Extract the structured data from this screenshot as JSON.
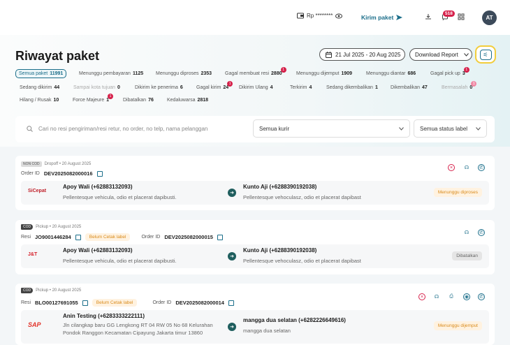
{
  "topbar": {
    "balance": "Rp ********",
    "kirim_paket": "Kirim paket",
    "notif_count": "518",
    "avatar": "AT"
  },
  "page": {
    "title": "Riwayat paket",
    "date_range": "21 Jul 2025 - 20 Aug 2025",
    "download_report": "Download Report"
  },
  "chips": [
    {
      "label": "Semua paket",
      "count": "11991"
    },
    {
      "label": "Menunggu pembayaran",
      "count": "1125"
    },
    {
      "label": "Menunggu diproses",
      "count": "2353"
    },
    {
      "label": "Gagal membuat resi",
      "count": "2880"
    },
    {
      "label": "Menunggu dijemput",
      "count": "1909"
    },
    {
      "label": "Menunggu diantar",
      "count": "686"
    },
    {
      "label": "Gagal pick up",
      "count": "3"
    },
    {
      "label": "Sedang dikirim",
      "count": "44"
    },
    {
      "label": "Sampai kota tujuan",
      "count": "0"
    },
    {
      "label": "Dikirim ke penerima",
      "count": "6"
    },
    {
      "label": "Gagal kirim",
      "count": "24"
    },
    {
      "label": "Dikirim Ulang",
      "count": "4"
    },
    {
      "label": "Terkirim",
      "count": "4"
    },
    {
      "label": "Sedang dikembalikan",
      "count": "1"
    },
    {
      "label": "Dikembalikan",
      "count": "47"
    },
    {
      "label": "Bermasalah",
      "count": "0"
    },
    {
      "label": "Hilang / Rusak",
      "count": "10"
    },
    {
      "label": "Force Majeure",
      "count": "1"
    },
    {
      "label": "Dibatalkan",
      "count": "76"
    },
    {
      "label": "Kedaluwarsa",
      "count": "2818"
    }
  ],
  "chip_badges": [
    "1",
    "1",
    "1",
    "1",
    "1"
  ],
  "search": {
    "placeholder": "Cari no resi pengiriman/resi retur, no order, no telp, nama pelanggan",
    "courier": "Semua kurir",
    "label_status": "Semua status label"
  },
  "orders": [
    {
      "cod_tag": "NON COD",
      "meta": "Dropoff • 20 August 2025",
      "order_id_label": "Order ID",
      "order_id": "DEV2025082000016",
      "courier": "SiCepat",
      "sender_name": "Apoy Wali (+62883132093)",
      "sender_address": "Pellentesque vehicula, odio et placerat dapibusti.",
      "receiver_name": "Kunto Aji (+6288390192038)",
      "receiver_address": "Pellentesque vehoculasz, odio et placerat dapibast",
      "status": "Menunggu diproses"
    },
    {
      "cod_tag": "COD",
      "meta": "Pickup • 20 August 2025",
      "resi_label": "Resi",
      "resi": "JO9001446284",
      "label_status": "Belum Cetak label",
      "order_id_label": "Order ID",
      "order_id": "DEV2025082000015",
      "courier": "J&T",
      "sender_name": "Apoy Wali (+62883132093)",
      "sender_address": "Pellentesque vehicula, odio et placerat dapibusti.",
      "receiver_name": "Kunto Aji (+6288390192038)",
      "receiver_address": "Pellentesque vehoculasz, odio et placerat dapibast",
      "status": "Dibatalkan"
    },
    {
      "cod_tag": "COD",
      "meta": "Pickup • 20 August 2025",
      "resi_label": "Resi",
      "resi": "BLO00127691055",
      "label_status": "Belum Cetak label",
      "order_id_label": "Order ID",
      "order_id": "DEV2025082000014",
      "courier": "SAP",
      "sender_name": "Anin Testing (+6283333222111)",
      "sender_address": "Jln cilangkap baru GG Lengkong RT 04 RW 05 No 68 Kelurahan Pondok Ranggon Kecamatan Cipayung Jakarta timur 13860",
      "receiver_name": "mangga dua selatan (+6282226649616)",
      "receiver_address": "mangga dua selatan",
      "status": "Menunggu dijemput"
    }
  ],
  "colors": {
    "accent": "#1b6e8a",
    "badge": "#d6204a",
    "warning_bg": "#fff2e0",
    "warning_text": "#d98b1c"
  }
}
